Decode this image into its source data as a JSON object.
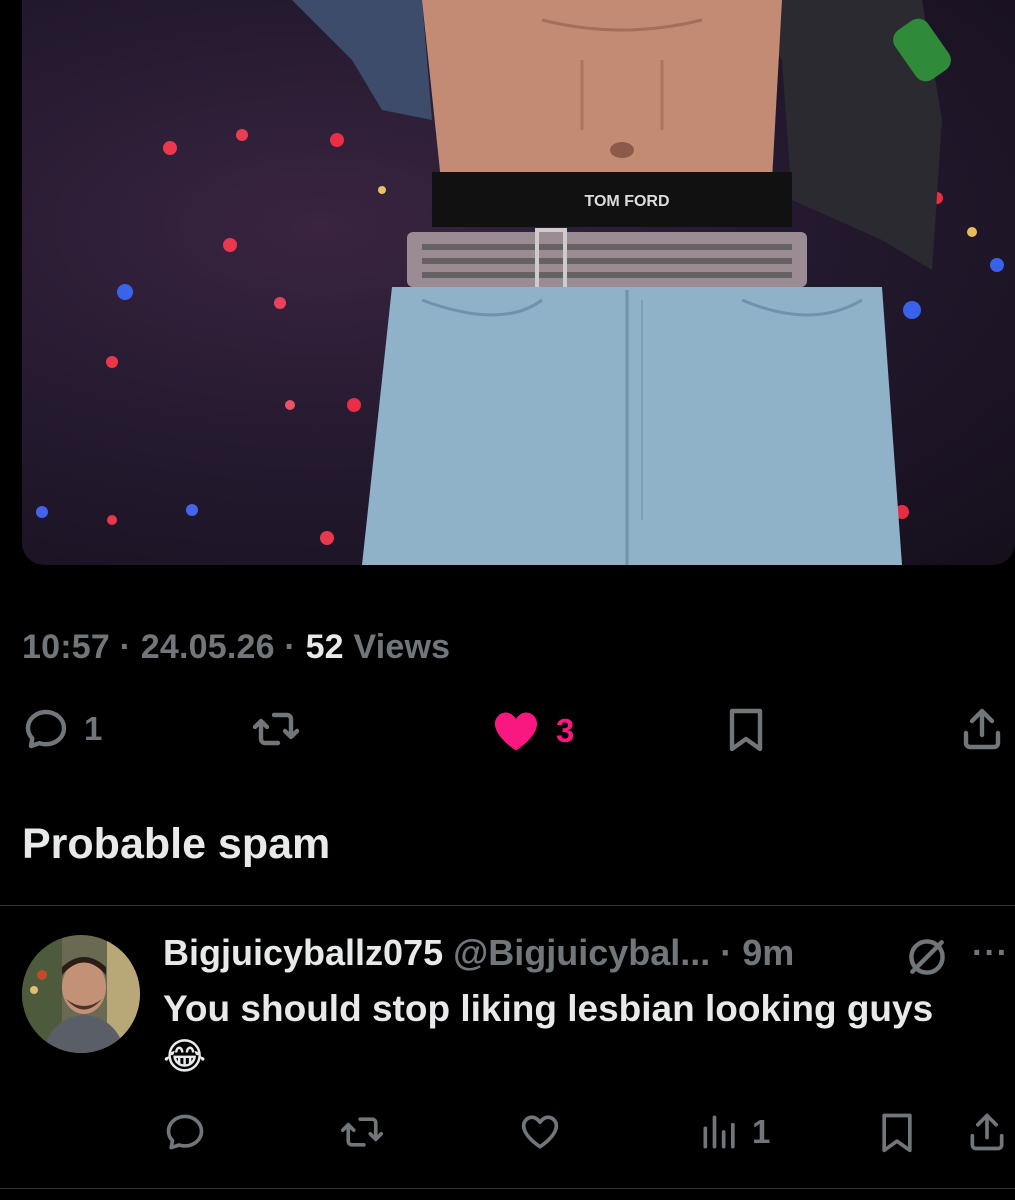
{
  "tweet": {
    "time": "10:57",
    "sep": " · ",
    "date": "24.05.26",
    "views_count": "52",
    "views_label": " Views",
    "image_brand": "TOM FORD",
    "actions": {
      "reply_count": "1",
      "like_count": "3"
    }
  },
  "section_title": "Probable spam",
  "reply": {
    "name": "Bigjuicyballz075",
    "handle": "@Bigjuicybal...",
    "dot": " · ",
    "time": "9m",
    "more": "···",
    "text": "You should stop liking lesbian looking guys",
    "emoji": "😂",
    "views_count": "1"
  },
  "colors": {
    "like_pink": "#f91880",
    "muted": "#71767b",
    "text": "#e7e9ea"
  }
}
